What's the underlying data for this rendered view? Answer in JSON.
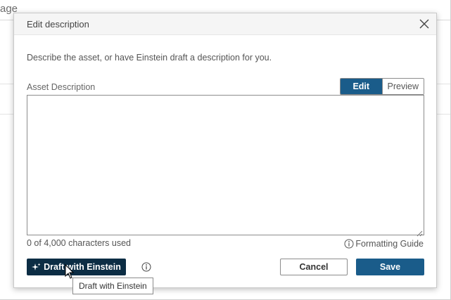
{
  "background": {
    "title_fragment": "age"
  },
  "dialog": {
    "title": "Edit description",
    "close_icon": "close-icon",
    "intro_text": "Describe the asset, or have Einstein draft a description for you.",
    "field_label": "Asset Description",
    "toggle": {
      "edit_label": "Edit",
      "preview_label": "Preview",
      "selected": "Edit"
    },
    "textarea_value": "",
    "char_count": "0 of 4,000 characters used",
    "formatting_guide": "Formatting Guide",
    "draft_button": "Draft with Einstein",
    "cancel_button": "Cancel",
    "save_button": "Save",
    "tooltip": "Draft with Einstein"
  },
  "colors": {
    "primary": "#1a5c8a",
    "einstein_dark": "#0c2d44"
  }
}
